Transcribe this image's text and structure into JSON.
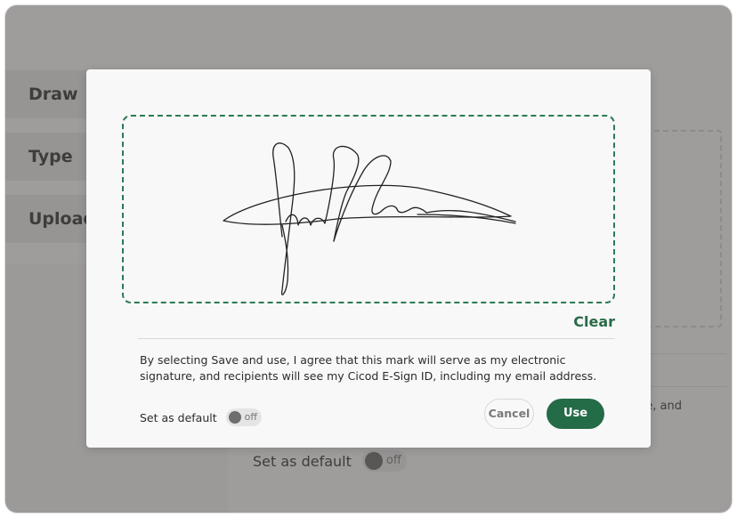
{
  "background": {
    "tabs": [
      "Draw",
      "Type",
      "Upload"
    ],
    "text_fragment": "ure, and",
    "default_label": "Set as default",
    "default_toggle": "off"
  },
  "modal": {
    "clear_label": "Clear",
    "consent_text": "By selecting Save and use, I agree that this mark will serve as my electronic signature, and recipients will see my Cicod E-Sign ID, including my email address.",
    "default_label": "Set as default",
    "default_toggle": "off",
    "cancel_label": "Cancel",
    "use_label": "Use",
    "accent_color": "#246b47"
  }
}
